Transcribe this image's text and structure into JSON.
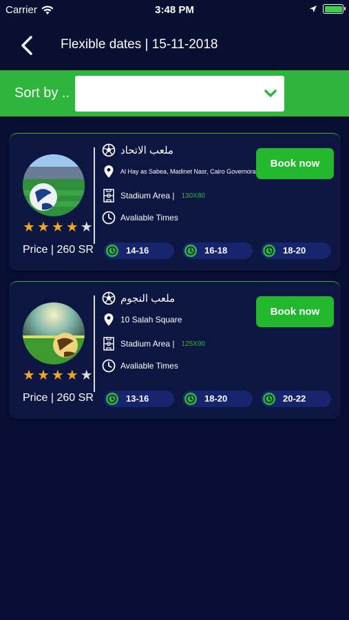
{
  "status_bar": {
    "carrier": "Carrier",
    "time": "3:48 PM"
  },
  "nav": {
    "title": "Flexible dates | 15-11-2018"
  },
  "sort": {
    "label": "Sort by ..",
    "selected": ""
  },
  "colors": {
    "background": "#070f33",
    "accent_green": "#2fb43c",
    "card": "#0c1640",
    "slot": "#17256f",
    "star": "#f5a623"
  },
  "stadiums": [
    {
      "name": "ملعب الاتحاد",
      "address": "Al Hay as Sabea, Madinet Nasr, Cairo Governorat",
      "area_label": "Stadium Area |",
      "area_value": "130X80",
      "times_label": "Avaliable Times",
      "book_label": "Book now",
      "price": "Price | 260 SR",
      "rating": 4,
      "rating_max": 5,
      "slots": [
        "14-16",
        "16-18",
        "18-20"
      ]
    },
    {
      "name": "ملعب النجوم",
      "address": "10 Salah Square",
      "area_label": "Stadium Area |",
      "area_value": "125X90",
      "times_label": "Avaliable Times",
      "book_label": "Book now",
      "price": "Price | 260 SR",
      "rating": 4,
      "rating_max": 5,
      "slots": [
        "13-16",
        "18-20",
        "20-22"
      ]
    }
  ]
}
